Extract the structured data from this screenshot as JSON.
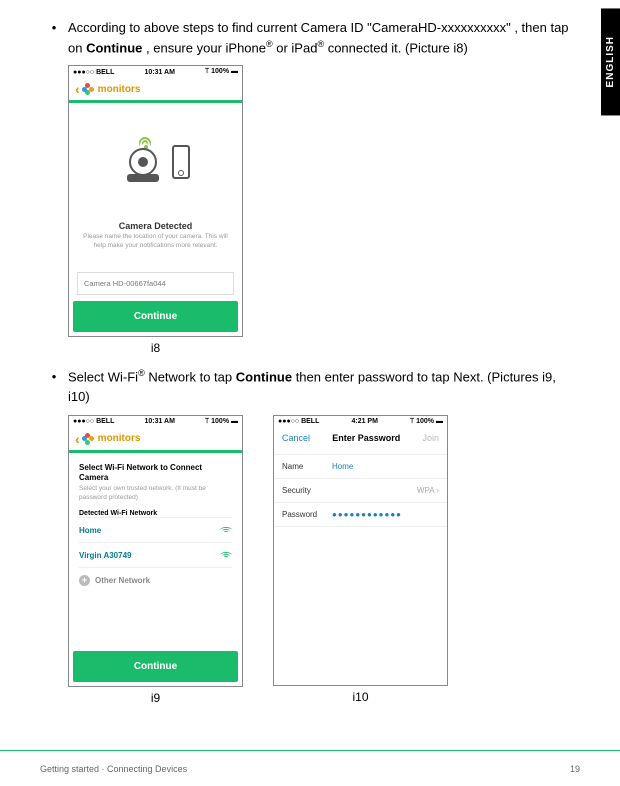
{
  "lang_tab": "ENGLISH",
  "bullets": {
    "b1_pre": "According to above steps to find current Camera ID \"CameraHD-xxxxxxxxxx\" , then tap on ",
    "b1_bold": "Continue",
    "b1_mid": " , ensure your iPhone",
    "b1_mid2": " or iPad",
    "b1_end": " connected it. (Picture i8)",
    "b2_pre": "Select Wi-Fi",
    "b2_mid": " Network to tap ",
    "b2_bold": "Continue",
    "b2_end": " then enter password to tap Next. (Pictures i9, i10)",
    "reg": "®"
  },
  "statusbar": {
    "carrier": "●●●○○ BELL",
    "wifi": "⚞",
    "time1": "10:31 AM",
    "time2": "4:21 PM",
    "batt": "100%"
  },
  "nav": {
    "monitors": "monitors"
  },
  "i8": {
    "heading": "Camera Detected",
    "sub": "Please name the location of your camera. This will help make your notifications more relevant.",
    "camid": "Camera HD-00667fa044",
    "continue": "Continue",
    "caption": "i8"
  },
  "i9": {
    "heading": "Select Wi-Fi Network to Connect Camera",
    "sub": "Select your own trusted network. (It must be password protected)",
    "detected": "Detected Wi-Fi Network",
    "net1": "Home",
    "net2": "Virgin A30749",
    "other": "Other Network",
    "continue": "Continue",
    "caption": "i9"
  },
  "i10": {
    "cancel": "Cancel",
    "title": "Enter Password",
    "join": "Join",
    "name_lbl": "Name",
    "name_val": "Home",
    "sec_lbl": "Security",
    "sec_val": "WPA",
    "pw_lbl": "Password",
    "pw_val": "●●●●●●●●●●●●",
    "caption": "i10"
  },
  "footer": {
    "left": "Getting started · Connecting Devices",
    "right": "19"
  }
}
